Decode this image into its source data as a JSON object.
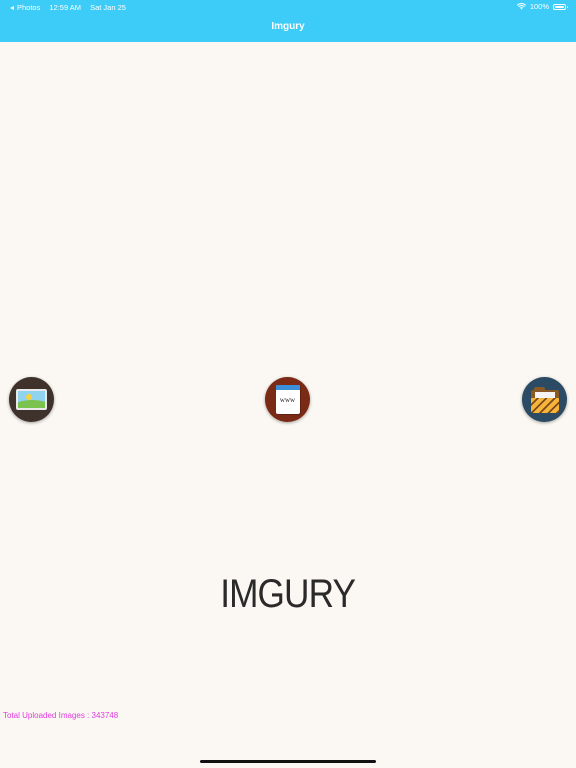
{
  "status_bar": {
    "back_app": "Photos",
    "time": "12:59 AM",
    "date": "Sat Jan 25",
    "battery_percent": "100%",
    "battery_level": 1.0
  },
  "nav": {
    "title": "Imgury"
  },
  "actions": [
    {
      "name": "gallery",
      "icon": "photo-gallery-icon"
    },
    {
      "name": "web",
      "icon": "web-page-icon",
      "label": "www"
    },
    {
      "name": "folder",
      "icon": "folder-icon"
    }
  ],
  "logo_text": "IMGURY",
  "stats": {
    "total_uploaded": "Total Uploaded Images : 343748"
  },
  "colors": {
    "nav_background": "#3dccf7",
    "page_background": "#fbf8f3",
    "stats_text": "#e03be0"
  }
}
